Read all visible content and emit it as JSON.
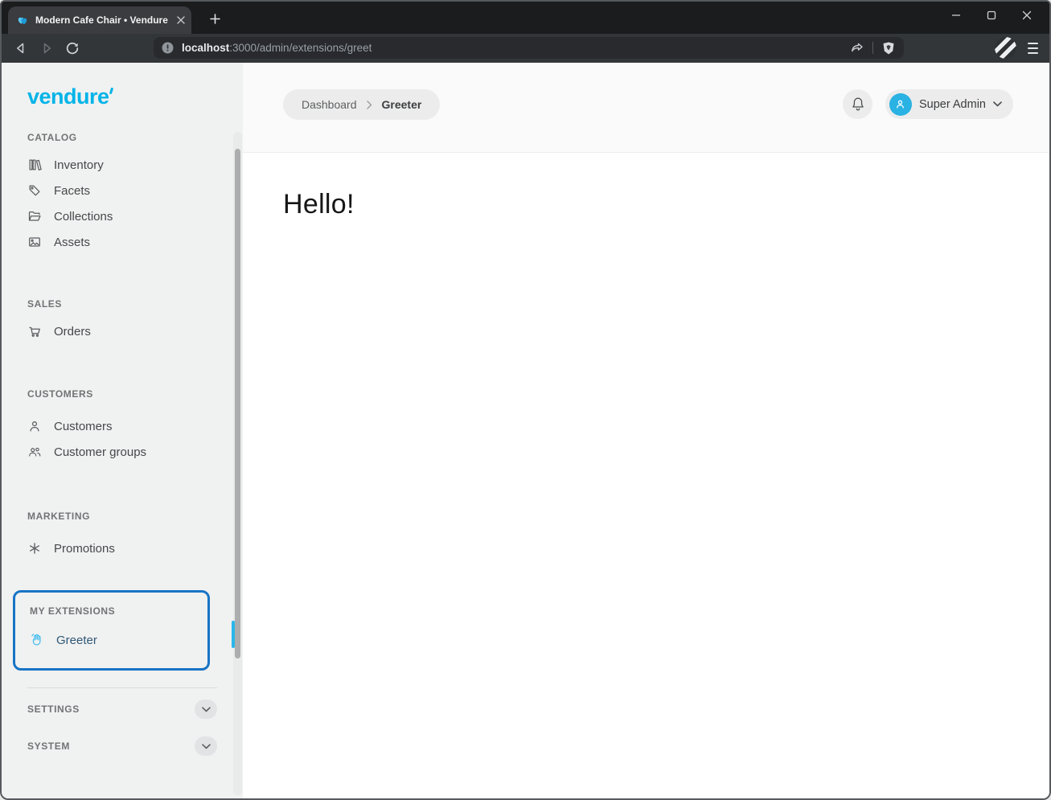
{
  "browser": {
    "tab_title": "Modern Cafe Chair • Vendure",
    "url_host": "localhost",
    "url_rest": ":3000/admin/extensions/greet",
    "icons": [
      "vendure-favicon",
      "tab-close-icon",
      "new-tab-icon",
      "back-icon",
      "forward-icon",
      "reload-icon",
      "site-info-icon",
      "share-icon",
      "brave-shield-icon",
      "profile-avatar",
      "menu-icon",
      "minimize-icon",
      "maximize-icon",
      "close-icon"
    ]
  },
  "sidebar": {
    "logo_text": "vendure",
    "sections": [
      {
        "label": "CATALOG",
        "items": [
          {
            "label": "Inventory",
            "icon": "library-icon"
          },
          {
            "label": "Facets",
            "icon": "tag-icon"
          },
          {
            "label": "Collections",
            "icon": "folder-icon"
          },
          {
            "label": "Assets",
            "icon": "image-icon"
          }
        ]
      },
      {
        "label": "SALES",
        "items": [
          {
            "label": "Orders",
            "icon": "cart-icon"
          }
        ]
      },
      {
        "label": "CUSTOMERS",
        "items": [
          {
            "label": "Customers",
            "icon": "user-icon"
          },
          {
            "label": "Customer groups",
            "icon": "users-icon"
          }
        ]
      },
      {
        "label": "MARKETING",
        "items": [
          {
            "label": "Promotions",
            "icon": "asterisk-icon"
          }
        ]
      },
      {
        "label": "MY EXTENSIONS",
        "highlighted": true,
        "items": [
          {
            "label": "Greeter",
            "icon": "hand-icon",
            "active": true
          }
        ]
      }
    ],
    "collapsed_sections": [
      {
        "label": "SETTINGS"
      },
      {
        "label": "SYSTEM"
      }
    ]
  },
  "header": {
    "breadcrumb_home": "Dashboard",
    "breadcrumb_current": "Greeter",
    "user_label": "Super Admin"
  },
  "content": {
    "greeting": "Hello!"
  },
  "colors": {
    "brand_cyan": "#00b4e8",
    "highlight_border": "#1874c5",
    "active_indicator": "#2bb7ea",
    "active_link": "#2f5876"
  }
}
